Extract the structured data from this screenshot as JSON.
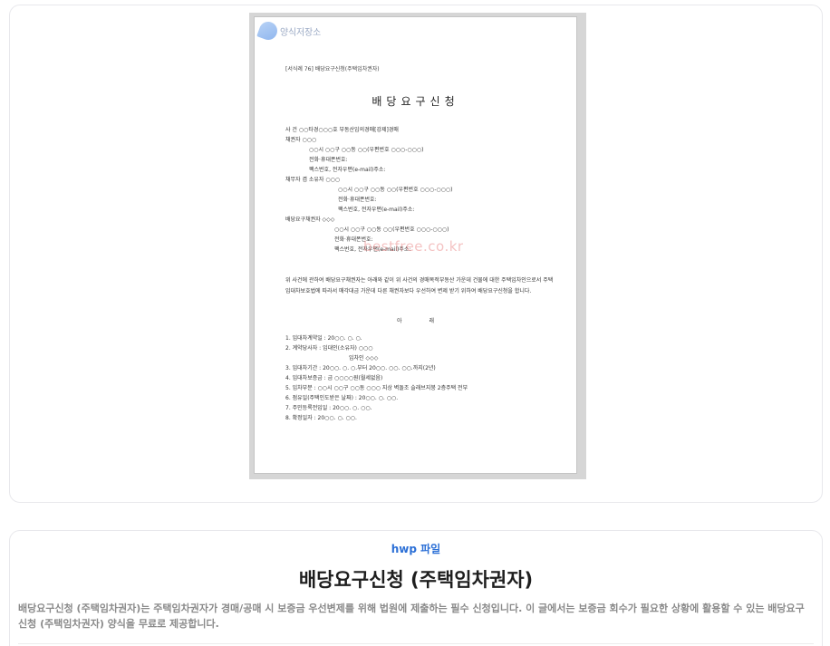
{
  "preview": {
    "brand_name": "양식저장소",
    "watermark": "bestfree.co.kr",
    "form_number": "[서식례 76] 배당요구신청(주택임차권자)",
    "doc_title": "배당요구신청",
    "lines": [
      "사      건   ○○타경○○○호 부동산임의경매[강제]경매",
      "채권자  ○○○",
      "○○시 ○○구 ○○동 ○○(우편번호 ○○○-○○○)",
      "전화·휴대폰번호:",
      "팩스번호, 전자우편(e-mail)주소:",
      "채무자 겸 소유자   ○○○",
      "○○시 ○○구 ○○동 ○○(우편번호 ○○○-○○○)",
      "전화·휴대폰번호:",
      "팩스번호, 전자우편(e-mail)주소:",
      "배당요구채권자   ◇◇◇",
      "○○시 ○○구 ○○동 ○○(우편번호 ○○○-○○○)",
      "전화·휴대폰번호:",
      "팩스번호, 전자우편(e-mail)주소:"
    ],
    "body_text": "위 사건에 관하여 배당요구채권자는 아래와 같이 위 사건의 경매목적부동산 가운데 건물에 대한 주택임차인으로서 주택임대차보호법에 따라서 매각대금 가운데 다른 채권자보다 우선하여 변제 받기 위하여 배당요구신청을 합니다.",
    "center_label": "아 래",
    "items": [
      "1. 임대차계약일 : 20○○. ○. ○.",
      "2. 계약당사자   : 임대인(소유자)  ○○○",
      "임차인        ◇◇◇",
      "3. 임대차기간  : 20○○. ○. ○.부터 20○○. ○○. ○○.까지(2년)",
      "4. 임대차보증금 : 금 ○○○○원(월세없음)",
      "5. 임차부분 : ○○시 ○○구 ○○동 ○○○ 지상 벽돌조 슬래브지붕 2층주택 전부",
      "6. 점유일(주택인도받은 날짜) : 20○○. ○. ○○.",
      "7. 주민등록전입일 : 20○○. ○. ○○.",
      "8. 확정일자 : 20○○. ○. ○○."
    ]
  },
  "detail": {
    "file_type": "hwp 파일",
    "title": "배당요구신청 (주택임차권자)",
    "description": "배당요구신청 (주택임차권자)는 주택임차권자가 경매/공매 시 보증금 우선변제를 위해 법원에 제출하는 필수 신청입니다. 이 글에서는 보증금 회수가 필요한 상황에 활용할 수 있는 배당요구신청 (주택임차권자) 양식을 무료로 제공합니다."
  }
}
